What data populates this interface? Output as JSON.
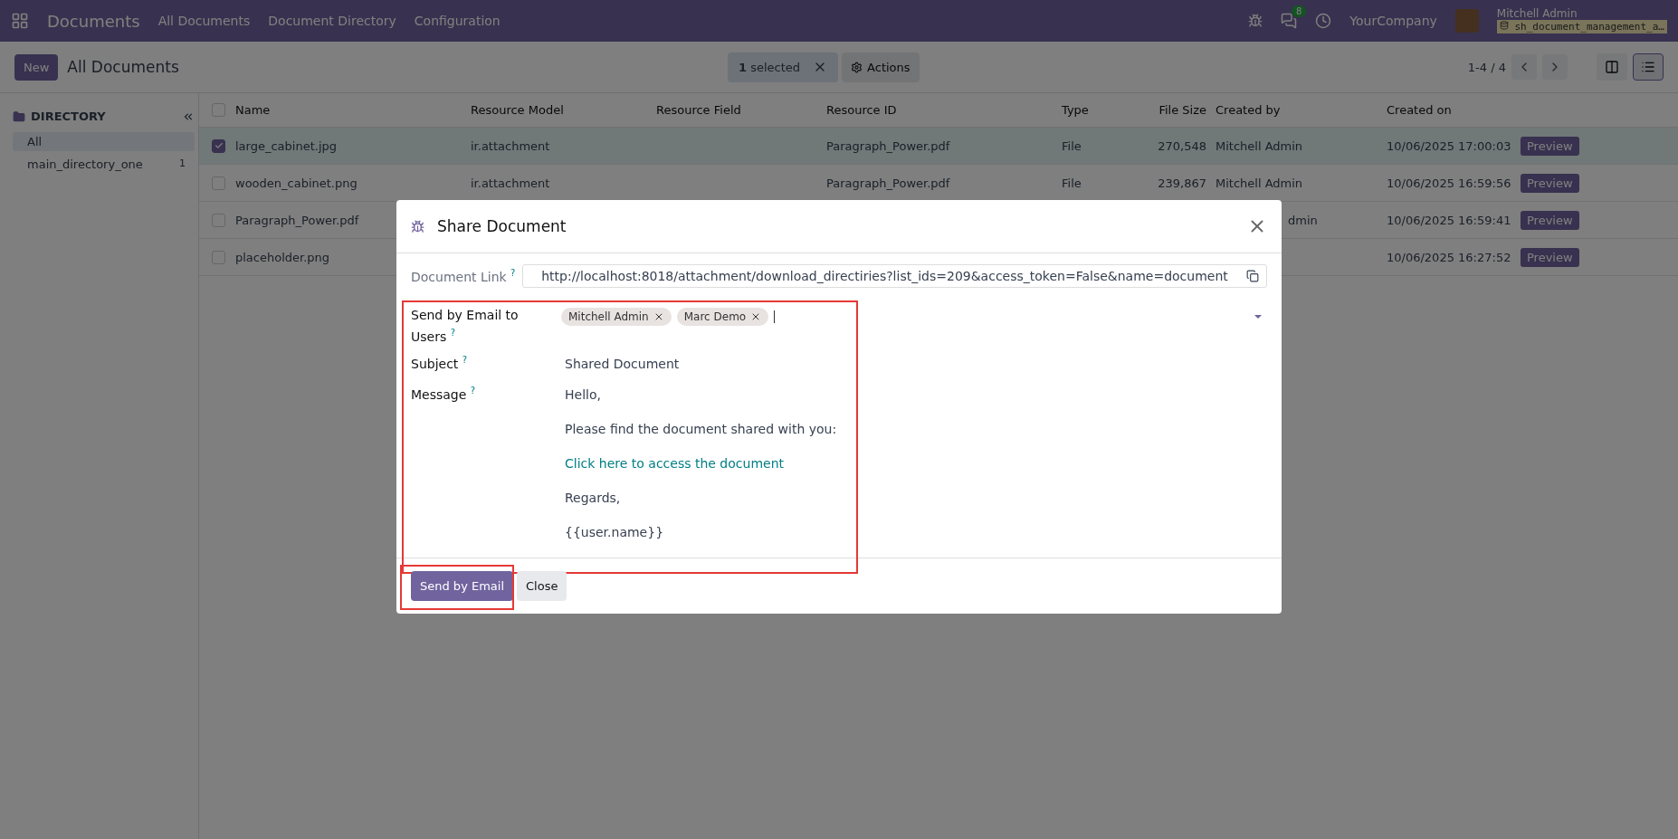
{
  "navbar": {
    "app": "Documents",
    "menus": [
      "All Documents",
      "Document Directory",
      "Configuration"
    ],
    "chat_count": "8",
    "company": "YourCompany",
    "user": "Mitchell Admin",
    "database": "sh_document_management_a…"
  },
  "control_panel": {
    "new_button": "New",
    "breadcrumb": "All Documents",
    "selection": {
      "count": "1",
      "label": " selected"
    },
    "actions": "Actions",
    "pager": "1-4 / 4",
    "views": [
      {
        "kind": "kanban",
        "selected": false
      },
      {
        "kind": "list",
        "selected": true
      }
    ]
  },
  "sidebar": {
    "title": "DIRECTORY",
    "items": [
      {
        "label": "All",
        "selected": true
      },
      {
        "label": "main_directory_one",
        "count": "1",
        "selected": false
      }
    ]
  },
  "table": {
    "all_checked": false,
    "columns": [
      "Name",
      "Resource Model",
      "Resource Field",
      "Resource ID",
      "Type",
      "File Size",
      "Created by",
      "Created on"
    ],
    "rows": [
      {
        "selected": true,
        "cells": [
          "large_cabinet.jpg",
          "ir.attachment",
          "",
          "Paragraph_Power.pdf",
          "File",
          "270,548",
          "Mitchell Admin",
          "10/06/2025 17:00:03"
        ],
        "preview": "Preview"
      },
      {
        "selected": false,
        "cells": [
          "wooden_cabinet.png",
          "ir.attachment",
          "",
          "Paragraph_Power.pdf",
          "File",
          "239,867",
          "Mitchell Admin",
          "10/06/2025 16:59:56"
        ],
        "preview": "Preview"
      },
      {
        "selected": false,
        "cells": [
          "Paragraph_Power.pdf",
          "",
          "",
          "",
          "",
          "",
          "dmin",
          "10/06/2025 16:59:41"
        ],
        "preview": "Preview"
      },
      {
        "selected": false,
        "cells": [
          "placeholder.png",
          "",
          "",
          "",
          "",
          "",
          "",
          "10/06/2025 16:27:52"
        ],
        "preview": "Preview"
      }
    ]
  },
  "dialog": {
    "title": "Share Document",
    "link_label": "Document Link",
    "link": "http://localhost:8018/attachment/download_directiries?list_ids=209&access_token=False&name=document",
    "users_label": "Send by Email to Users",
    "users": [
      "Mitchell Admin",
      "Marc Demo"
    ],
    "subject_label": "Subject",
    "subject": "Shared Document",
    "message_label": "Message",
    "message": [
      {
        "kind": "text",
        "text": "Hello,"
      },
      {
        "kind": "text",
        "text": "Please find the document shared with you:"
      },
      {
        "kind": "link",
        "text": "Click here to access the document"
      },
      {
        "kind": "text",
        "text": "Regards,"
      },
      {
        "kind": "text",
        "text": "{{user.name}}"
      }
    ],
    "help_mark": "?",
    "send_button": "Send by Email",
    "close_button": "Close"
  }
}
